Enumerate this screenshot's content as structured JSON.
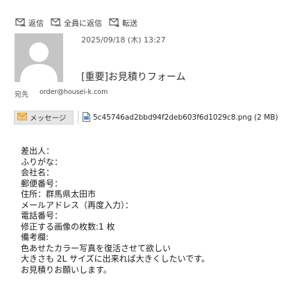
{
  "toolbar": {
    "reply_label": "返信",
    "reply_all_label": "全員に返信",
    "forward_label": "転送"
  },
  "header": {
    "date": "2025/09/18 (木) 13:27",
    "subject": "[重要]お見積りフォーム",
    "to_label": "宛先",
    "to_value": "order@housei-k.com"
  },
  "attachments": {
    "message_tab_label": "メッセージ",
    "file_label": "5c45746ad2bbd94f2deb603f6d1029c8.png (2 MB)"
  },
  "body": {
    "lines": [
      "差出人：",
      "ふりがな：",
      "会社名：",
      "郵便番号：",
      "住所：群馬県太田市",
      "メールアドレス（再度入力）：",
      "電話番号：",
      "修正する画像の枚数:1 枚",
      "備考欄:",
      "色あせたカラー写真を復活させて欲しい",
      "大きさも 2L サイズに出来れば大きくしたいです。",
      "お見積りお願いします。"
    ]
  },
  "icons": {
    "reply": "reply-envelope-icon",
    "reply_all": "reply-all-envelope-icon",
    "forward": "forward-envelope-icon",
    "message": "envelope-icon",
    "file": "document-icon"
  },
  "colors": {
    "avatar_bg": "#c5c5c5",
    "envelope_icon": "#e9b25a"
  }
}
